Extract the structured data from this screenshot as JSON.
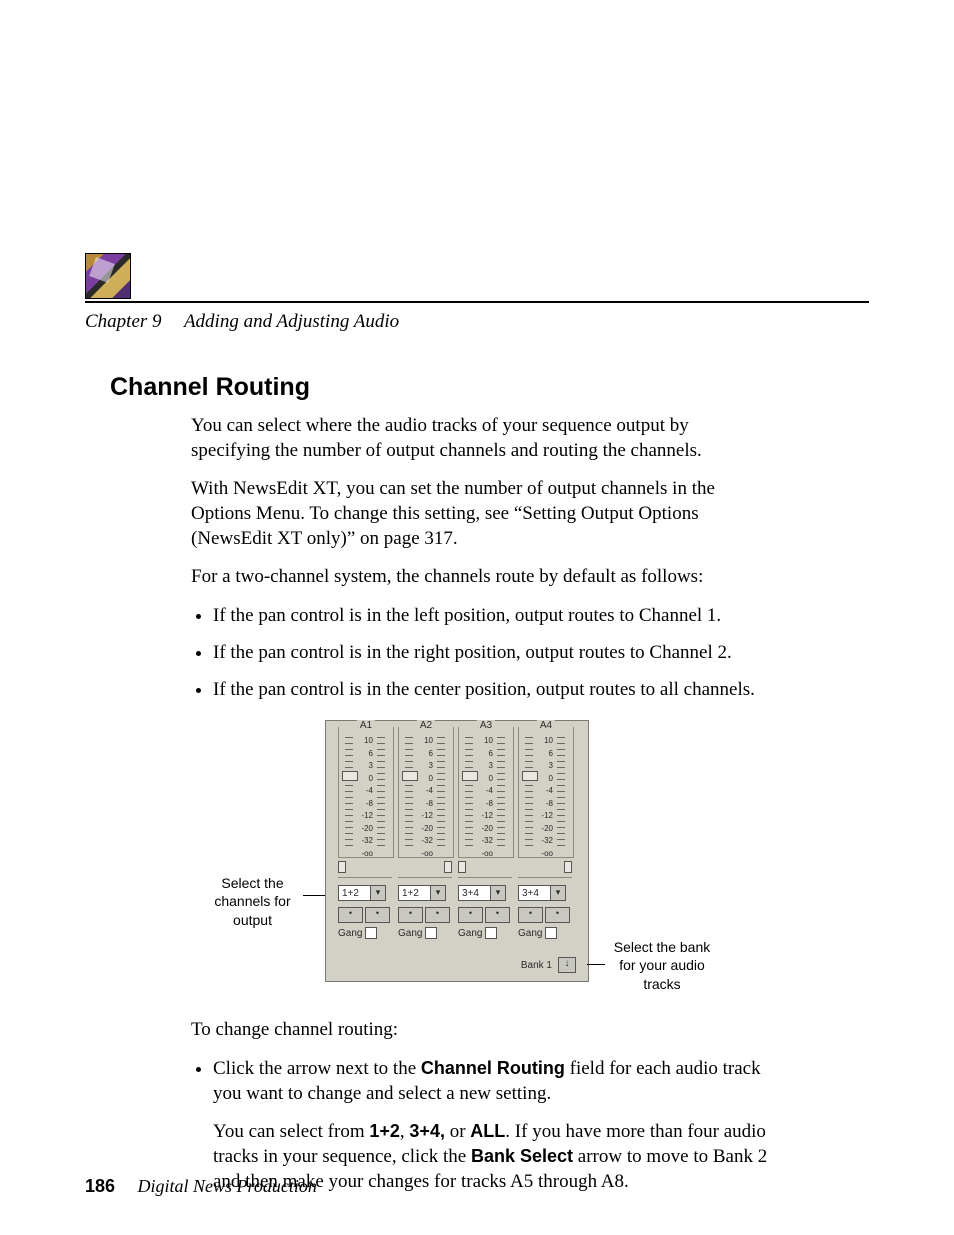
{
  "header": {
    "chapter_label": "Chapter 9",
    "chapter_title": "Adding and Adjusting Audio"
  },
  "section": {
    "title": "Channel Routing",
    "p1": "You can select where the audio tracks of your sequence output by specifying the number of output channels and routing the channels.",
    "p2": "With NewsEdit XT, you can set the number of output channels in the Options Menu. To change this setting, see “Setting Output Options (NewsEdit XT only)” on page 317.",
    "p3": "For a two-channel system, the channels route by default as follows:",
    "bullets": [
      "If the pan control is in the left position, output routes to Channel 1.",
      "If the pan control is in the right position, output routes to Channel 2.",
      "If the pan control is in the center position, output routes to all channels."
    ],
    "p4": "To change channel routing:",
    "step_pre": "Click the arrow next to the ",
    "step_bold1": "Channel Routing",
    "step_mid": " field for each audio track you want to change and select a new setting.",
    "note_pre": "You can select from ",
    "note_b1": "1+2",
    "note_c1": ", ",
    "note_b2": "3+4,",
    "note_c2": " or ",
    "note_b3": "ALL",
    "note_mid": ". If you have more than four audio tracks in your sequence, click the ",
    "note_b4": "Bank Select",
    "note_post": " arrow to move to Bank 2 and then make your changes for tracks A5 through A8."
  },
  "mixer": {
    "channels": [
      "A1",
      "A2",
      "A3",
      "A4"
    ],
    "scale": [
      "10",
      "6",
      "3",
      "0",
      "-4",
      "-8",
      "-12",
      "-20",
      "-32",
      "-oo"
    ],
    "route": [
      "1+2",
      "1+2",
      "3+4",
      "3+4"
    ],
    "btn_glyph": "•",
    "gang_label": "Gang",
    "bank_label": "Bank 1",
    "bank_arrow": "↓",
    "dropdown_arrow": "▾"
  },
  "annotations": {
    "left": "Select the channels for output",
    "right": "Select the bank for your audio tracks"
  },
  "footer": {
    "page": "186",
    "book": "Digital News Production"
  }
}
